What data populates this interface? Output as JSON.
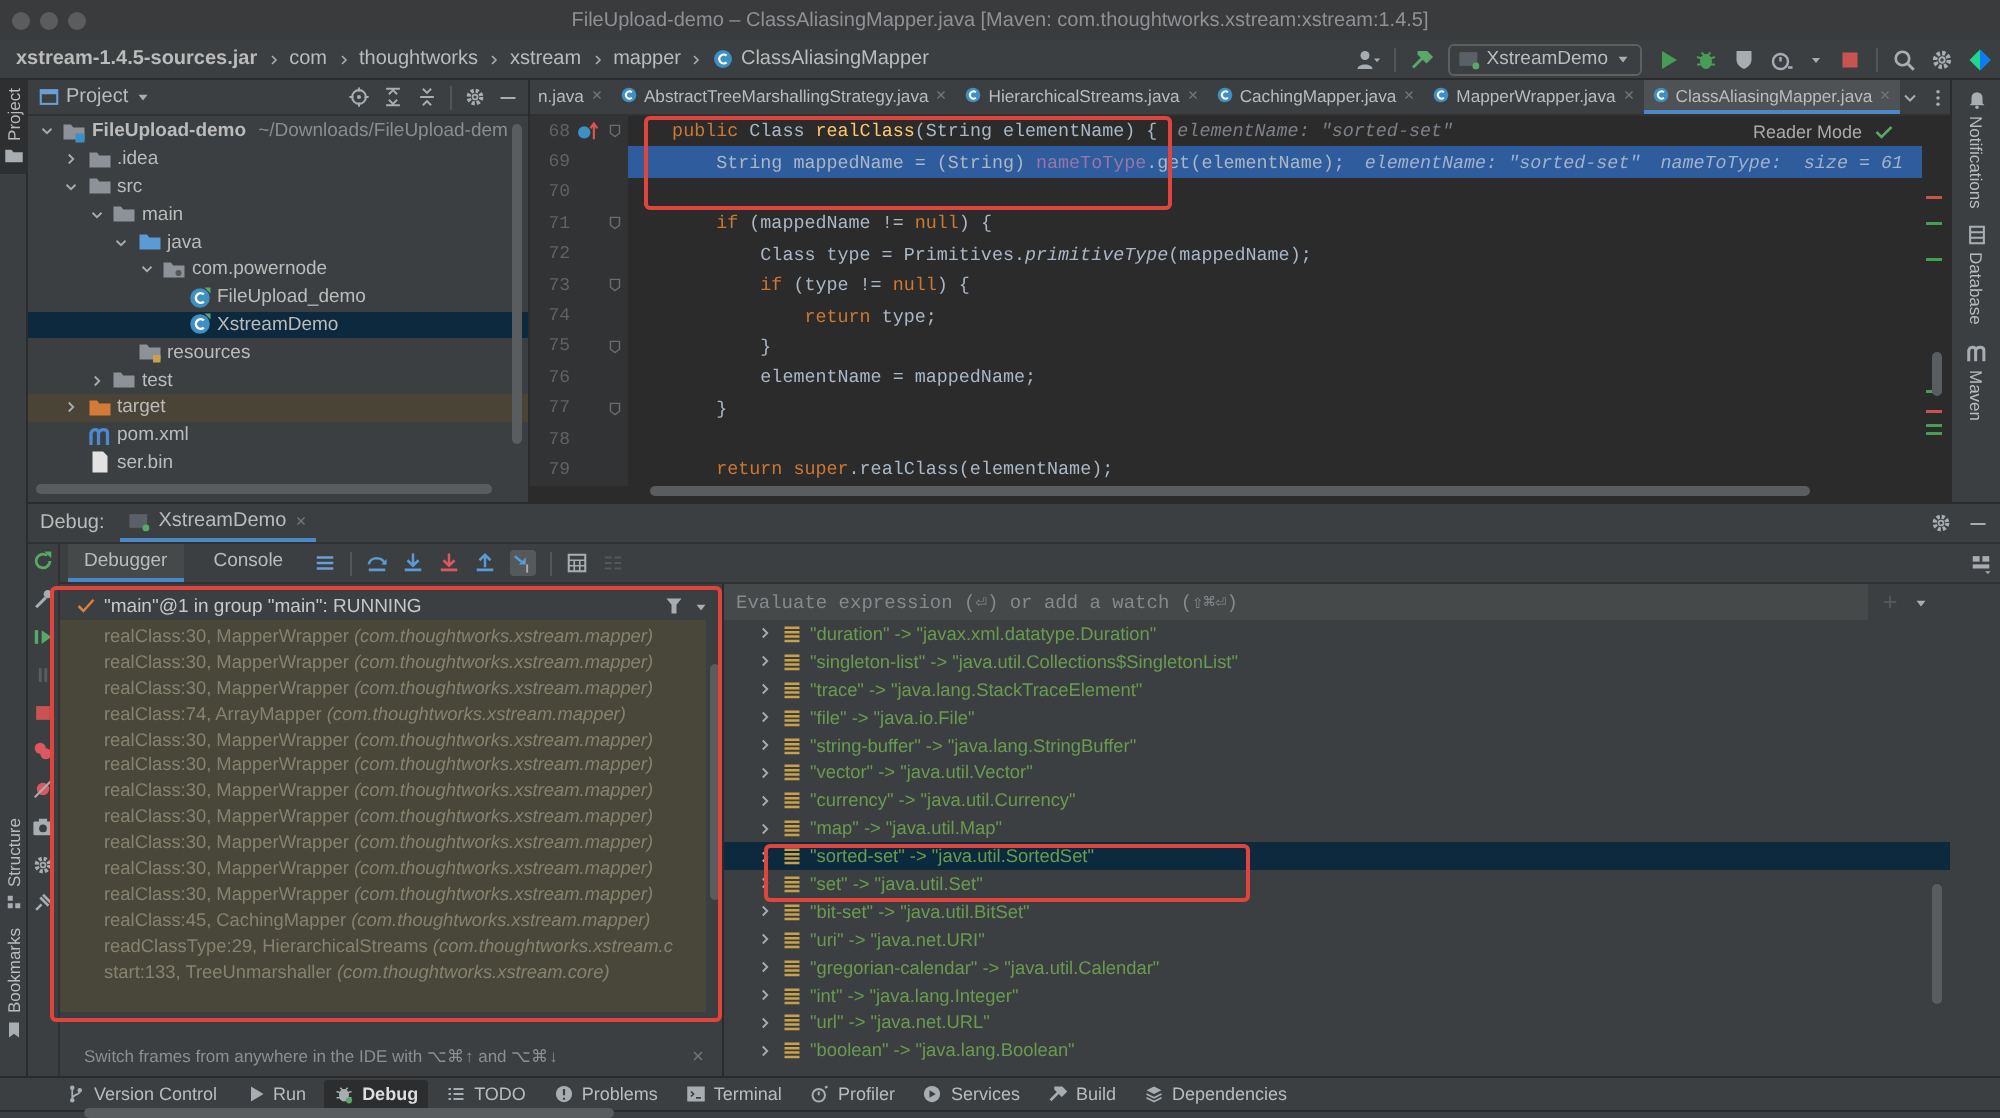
{
  "window": {
    "title": "FileUpload-demo – ClassAliasingMapper.java [Maven: com.thoughtworks.xstream:xstream:1.4.5]"
  },
  "breadcrumb": [
    {
      "label": "xstream-1.4.5-sources.jar",
      "kind": "jar"
    },
    {
      "label": "com",
      "kind": "folder"
    },
    {
      "label": "thoughtworks",
      "kind": "folder"
    },
    {
      "label": "xstream",
      "kind": "folder"
    },
    {
      "label": "mapper",
      "kind": "folder"
    },
    {
      "label": "ClassAliasingMapper",
      "kind": "class"
    }
  ],
  "run_config": {
    "label": "XstreamDemo"
  },
  "left_stripe": [
    {
      "label": "Project",
      "selected": true
    },
    {
      "label": "Structure",
      "selected": false
    },
    {
      "label": "Bookmarks",
      "selected": false
    }
  ],
  "right_stripe": [
    {
      "label": "Notifications"
    },
    {
      "label": "Database"
    },
    {
      "label": "Maven"
    }
  ],
  "project": {
    "title": "Project",
    "tree": [
      {
        "label": "FileUpload-demo",
        "note": "~/Downloads/FileUpload-dem",
        "kind": "module",
        "expanded": true,
        "selected": false,
        "children": [
          {
            "label": ".idea",
            "kind": "folder",
            "expanded": false,
            "selected": false
          },
          {
            "label": "src",
            "kind": "folder",
            "expanded": true,
            "selected": false,
            "children": [
              {
                "label": "main",
                "kind": "folder",
                "expanded": true,
                "selected": false,
                "children": [
                  {
                    "label": "java",
                    "kind": "source-folder",
                    "expanded": true,
                    "selected": false,
                    "children": [
                      {
                        "label": "com.powernode",
                        "kind": "package",
                        "expanded": true,
                        "selected": false,
                        "children": [
                          {
                            "label": "FileUpload_demo",
                            "kind": "class",
                            "selected": false
                          },
                          {
                            "label": "XstreamDemo",
                            "kind": "class",
                            "selected": true
                          }
                        ]
                      }
                    ]
                  },
                  {
                    "label": "resources",
                    "kind": "resource-folder",
                    "selected": false
                  }
                ]
              },
              {
                "label": "test",
                "kind": "folder",
                "expanded": false,
                "selected": false
              }
            ]
          },
          {
            "label": "target",
            "kind": "excluded-folder",
            "expanded": false,
            "selected": false
          },
          {
            "label": "pom.xml",
            "kind": "maven",
            "selected": false
          },
          {
            "label": "ser.bin",
            "kind": "file",
            "selected": false
          }
        ]
      }
    ]
  },
  "editor": {
    "tabs": [
      {
        "label": "n.java",
        "kind": "plain",
        "selected": false
      },
      {
        "label": "AbstractTreeMarshallingStrategy.java",
        "kind": "class",
        "selected": false
      },
      {
        "label": "HierarchicalStreams.java",
        "kind": "class",
        "selected": false
      },
      {
        "label": "CachingMapper.java",
        "kind": "class",
        "selected": false
      },
      {
        "label": "MapperWrapper.java",
        "kind": "class",
        "selected": false
      },
      {
        "label": "ClassAliasingMapper.java",
        "kind": "class",
        "selected": true
      }
    ],
    "reader_mode": "Reader Mode",
    "lines": [
      {
        "number": "68",
        "override": true,
        "fold": true,
        "selected": false,
        "tokens": [
          {
            "kind": "keyword",
            "text": "    public "
          },
          {
            "kind": "plain",
            "text": "Class "
          },
          {
            "kind": "method",
            "text": "realClass"
          },
          {
            "kind": "plain",
            "text": "(String elementName) {"
          }
        ],
        "hints": [
          "elementName: \"sorted-set\""
        ]
      },
      {
        "number": "69",
        "override": false,
        "fold": false,
        "selected": true,
        "tokens": [
          {
            "kind": "plain",
            "text": "        String mappedName = (String) "
          },
          {
            "kind": "field",
            "text": "nameToType"
          },
          {
            "kind": "plain",
            "text": ".get(elementName);"
          }
        ],
        "hints": [
          "elementName: \"sorted-set\"",
          "nameToType:  size = 61"
        ]
      },
      {
        "number": "70",
        "override": false,
        "fold": false,
        "selected": false
      },
      {
        "number": "71",
        "override": false,
        "fold": true,
        "selected": false,
        "tokens": [
          {
            "kind": "keyword",
            "text": "        if "
          },
          {
            "kind": "plain",
            "text": "(mappedName != "
          },
          {
            "kind": "keyword",
            "text": "null"
          },
          {
            "kind": "plain",
            "text": ") {"
          }
        ]
      },
      {
        "number": "72",
        "override": false,
        "fold": false,
        "selected": false,
        "tokens": [
          {
            "kind": "plain",
            "text": "            Class type = Primitives."
          },
          {
            "kind": "static-method",
            "text": "primitiveType"
          },
          {
            "kind": "plain",
            "text": "(mappedName);"
          }
        ]
      },
      {
        "number": "73",
        "override": false,
        "fold": true,
        "selected": false,
        "tokens": [
          {
            "kind": "keyword",
            "text": "            if "
          },
          {
            "kind": "plain",
            "text": "(type != "
          },
          {
            "kind": "keyword",
            "text": "null"
          },
          {
            "kind": "plain",
            "text": ") {"
          }
        ]
      },
      {
        "number": "74",
        "override": false,
        "fold": false,
        "selected": false,
        "tokens": [
          {
            "kind": "keyword",
            "text": "                return "
          },
          {
            "kind": "plain",
            "text": "type;"
          }
        ]
      },
      {
        "number": "75",
        "override": false,
        "fold": true,
        "selected": false,
        "tokens": [
          {
            "kind": "plain",
            "text": "            }"
          }
        ]
      },
      {
        "number": "76",
        "override": false,
        "fold": false,
        "selected": false,
        "tokens": [
          {
            "kind": "plain",
            "text": "            elementName = mappedName;"
          }
        ]
      },
      {
        "number": "77",
        "override": false,
        "fold": true,
        "selected": false,
        "tokens": [
          {
            "kind": "plain",
            "text": "        }"
          }
        ]
      },
      {
        "number": "78",
        "override": false,
        "fold": false,
        "selected": false
      },
      {
        "number": "79",
        "override": false,
        "fold": false,
        "selected": false,
        "tokens": [
          {
            "kind": "keyword",
            "text": "        return "
          },
          {
            "kind": "keyword",
            "text": "super"
          },
          {
            "kind": "plain",
            "text": ".realClass(elementName);"
          }
        ]
      }
    ]
  },
  "debug": {
    "title": "Debug:",
    "session_tab": "XstreamDemo",
    "tabs": [
      {
        "label": "Debugger",
        "selected": true
      },
      {
        "label": "Console",
        "selected": false
      }
    ],
    "thread": "\"main\"@1 in group \"main\": RUNNING",
    "frames": [
      "realClass:30, MapperWrapper *(com.thoughtworks.xstream.mapper)*",
      "realClass:30, MapperWrapper *(com.thoughtworks.xstream.mapper)*",
      "realClass:30, MapperWrapper *(com.thoughtworks.xstream.mapper)*",
      "realClass:74, ArrayMapper *(com.thoughtworks.xstream.mapper)*",
      "realClass:30, MapperWrapper *(com.thoughtworks.xstream.mapper)*",
      "realClass:30, MapperWrapper *(com.thoughtworks.xstream.mapper)*",
      "realClass:30, MapperWrapper *(com.thoughtworks.xstream.mapper)*",
      "realClass:30, MapperWrapper *(com.thoughtworks.xstream.mapper)*",
      "realClass:30, MapperWrapper *(com.thoughtworks.xstream.mapper)*",
      "realClass:30, MapperWrapper *(com.thoughtworks.xstream.mapper)*",
      "realClass:30, MapperWrapper *(com.thoughtworks.xstream.mapper)*",
      "realClass:45, CachingMapper *(com.thoughtworks.xstream.mapper)*",
      "readClassType:29, HierarchicalStreams *(com.thoughtworks.xstream.c*",
      "start:133, TreeUnmarshaller *(com.thoughtworks.xstream.core)*"
    ],
    "tip": "Switch frames from anywhere in the IDE with ⌥⌘↑ and ⌥⌘↓",
    "watch_placeholder": "Evaluate expression (⏎) or add a watch (⇧⌘⏎)",
    "variables": [
      {
        "text": "\"duration\" -> \"javax.xml.datatype.Duration\"",
        "selected": false
      },
      {
        "text": "\"singleton-list\" -> \"java.util.Collections$SingletonList\"",
        "selected": false
      },
      {
        "text": "\"trace\" -> \"java.lang.StackTraceElement\"",
        "selected": false
      },
      {
        "text": "\"file\" -> \"java.io.File\"",
        "selected": false
      },
      {
        "text": "\"string-buffer\" -> \"java.lang.StringBuffer\"",
        "selected": false
      },
      {
        "text": "\"vector\" -> \"java.util.Vector\"",
        "selected": false
      },
      {
        "text": "\"currency\" -> \"java.util.Currency\"",
        "selected": false
      },
      {
        "text": "\"map\" -> \"java.util.Map\"",
        "selected": false
      },
      {
        "text": "\"sorted-set\" -> \"java.util.SortedSet\"",
        "selected": true
      },
      {
        "text": "\"set\" -> \"java.util.Set\"",
        "selected": false
      },
      {
        "text": "\"bit-set\" -> \"java.util.BitSet\"",
        "selected": false
      },
      {
        "text": "\"uri\" -> \"java.net.URI\"",
        "selected": false
      },
      {
        "text": "\"gregorian-calendar\" -> \"java.util.Calendar\"",
        "selected": false
      },
      {
        "text": "\"int\" -> \"java.lang.Integer\"",
        "selected": false
      },
      {
        "text": "\"url\" -> \"java.net.URL\"",
        "selected": false
      },
      {
        "text": "\"boolean\" -> \"java.lang.Boolean\"",
        "selected": false
      }
    ]
  },
  "bottom_tools": [
    {
      "label": "Version Control",
      "selected": false
    },
    {
      "label": "Run",
      "selected": false
    },
    {
      "label": "Debug",
      "selected": true
    },
    {
      "label": "TODO",
      "selected": false
    },
    {
      "label": "Problems",
      "selected": false
    },
    {
      "label": "Terminal",
      "selected": false
    },
    {
      "label": "Profiler",
      "selected": false
    },
    {
      "label": "Services",
      "selected": false
    },
    {
      "label": "Build",
      "selected": false
    },
    {
      "label": "Dependencies",
      "selected": false
    }
  ]
}
